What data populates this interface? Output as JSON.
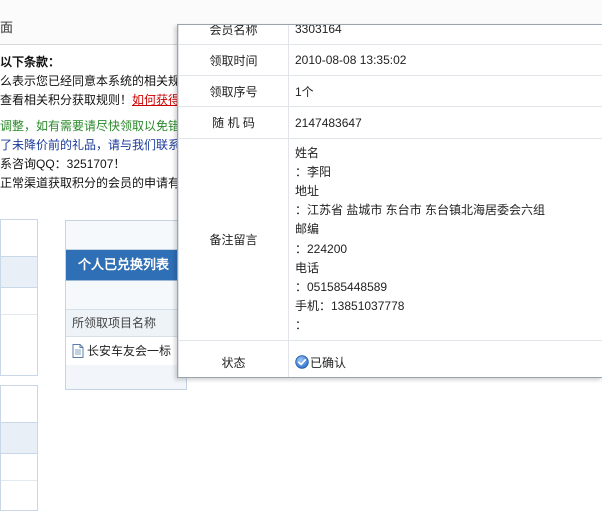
{
  "page": {
    "title_fragment": "面"
  },
  "notice": {
    "heading": "以下条款：",
    "line1": "么表示您已经同意本系统的相关规",
    "line2_text": "查看相关积分获取规则！",
    "line2_link": "如何获得",
    "line3": "调整，如有需要请尽快领取以免错",
    "line4": "了未降价前的礼品，请与我们联系",
    "line5": "系咨询QQ：3251707！",
    "line6": "正常渠道获取积分的会员的申请有"
  },
  "exchange_panel": {
    "header": "个人已兑换列表",
    "column_header": "所领取项目名称",
    "item": "长安车友会一标"
  },
  "details": {
    "member_name_label": "会员名称",
    "member_name_value": "3303164",
    "receive_time_label": "领取时间",
    "receive_time_value": "2010-08-08 13:35:02",
    "receive_seq_label": "领取序号",
    "receive_seq_value": "1个",
    "random_code_label": "随 机 码",
    "random_code_value": "2147483647",
    "remark_label": "备注留言",
    "remark_lines": [
      "姓名",
      "：李阳",
      "地址",
      "：江苏省 盐城市 东台市 东台镇北海居委会六组",
      "邮编",
      "：224200",
      "电话",
      "：051585448589",
      "手机：13851037778",
      "："
    ],
    "status_label": "状态",
    "status_value": "已确认",
    "status_icon": "check-circle-icon"
  }
}
